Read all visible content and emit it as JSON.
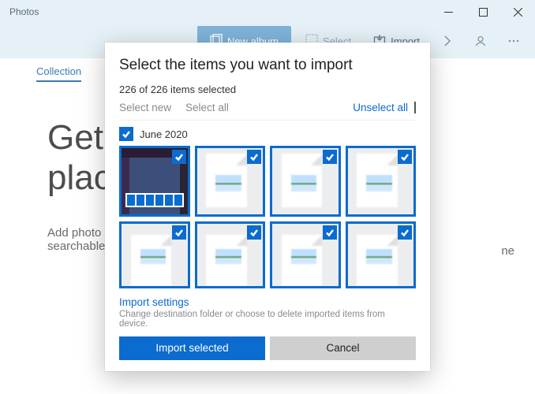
{
  "window": {
    "title": "Photos"
  },
  "toolbar": {
    "new_album": "New album",
    "select": "Select",
    "import": "Import"
  },
  "tabs": {
    "collection": "Collection"
  },
  "hero": {
    "line1_visible": "Get a",
    "line2_visible": "place",
    "desc_line1_visible": "Add photo",
    "desc_line2_visible": "searchable",
    "right_fragment": "ne"
  },
  "dialog": {
    "title": "Select the items you want to import",
    "count_text": "226 of 226 items selected",
    "select_new": "Select new",
    "select_all": "Select all",
    "unselect_all": "Unselect all",
    "group_label": "June 2020",
    "settings_link": "Import settings",
    "settings_sub": "Change destination folder or choose to delete imported items from device.",
    "import_btn": "Import selected",
    "cancel_btn": "Cancel"
  },
  "colors": {
    "accent": "#0b6bcf",
    "header_bg": "#e6f0f7"
  }
}
